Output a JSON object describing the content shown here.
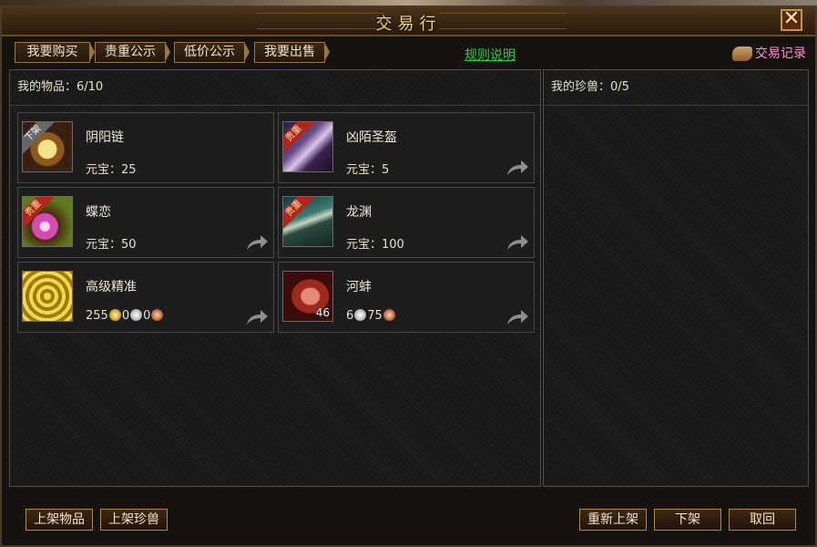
{
  "window": {
    "title": "交易行",
    "close_label": "✕"
  },
  "tabs": [
    {
      "label": "我要购买"
    },
    {
      "label": "贵重公示"
    },
    {
      "label": "低价公示"
    },
    {
      "label": "我要出售"
    }
  ],
  "links": {
    "rules": "规则说明",
    "trade_record": "交易记录"
  },
  "items_panel": {
    "title_label": "我的物品：6/10"
  },
  "pets_panel": {
    "title_label": "我的珍兽：0/5"
  },
  "items": [
    {
      "name": "阴阳链",
      "price_text": "元宝：25",
      "badge": "下架",
      "icon": "yin-yang-chain-icon"
    },
    {
      "name": "凶陌圣盔",
      "price_text": "元宝：5",
      "badge": "贵重",
      "icon": "helmet-icon"
    },
    {
      "name": "蝶恋",
      "price_text": "元宝：50",
      "badge": "贵重",
      "icon": "gem-pendant-icon"
    },
    {
      "name": "龙渊",
      "price_text": "元宝：100",
      "badge": "贵重",
      "icon": "dragon-weapon-icon"
    },
    {
      "name": "高级精准",
      "gold": "255",
      "silver": "0",
      "copper": "0",
      "icon": "precision-target-icon"
    },
    {
      "name": "河蚌",
      "count": "46",
      "silver": "6",
      "copper": "75",
      "icon": "river-clam-icon"
    }
  ],
  "buttons": {
    "list_item": "上架物品",
    "list_pet": "上架珍兽",
    "relist": "重新上架",
    "delist": "下架",
    "cancel": "取回"
  },
  "colors": {
    "accent": "#f3d27c",
    "link_green": "#27d43a",
    "link_pink": "#ff8fd0",
    "badge_red": "#b2261a"
  }
}
